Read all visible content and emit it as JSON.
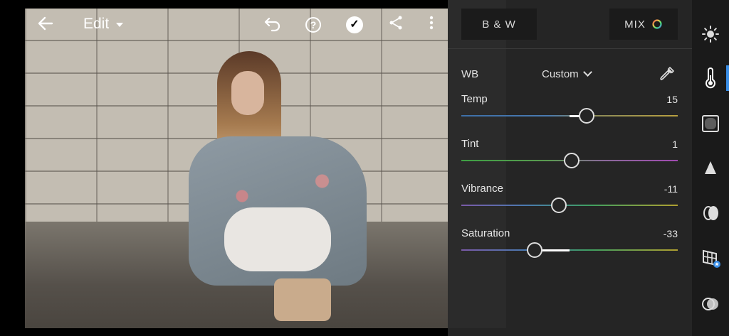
{
  "topbar": {
    "edit_label": "Edit",
    "icons": [
      "back-arrow-icon",
      "undo-icon",
      "help-icon",
      "done-check-icon",
      "share-icon",
      "more-vertical-icon"
    ]
  },
  "panel": {
    "bw_label": "B & W",
    "mix_label": "MIX",
    "wb_label": "WB",
    "wb_value": "Custom",
    "sliders": [
      {
        "label": "Temp",
        "value": "15",
        "position": 0.575
      },
      {
        "label": "Tint",
        "value": "1",
        "position": 0.505
      },
      {
        "label": "Vibrance",
        "value": "-11",
        "position": 0.445
      },
      {
        "label": "Saturation",
        "value": "-33",
        "position": 0.335
      }
    ]
  },
  "rail": {
    "icons": [
      "light-icon",
      "color-icon",
      "effects-icon",
      "detail-icon",
      "optics-icon",
      "geometry-icon",
      "presets-icon"
    ],
    "active": "color-icon",
    "accent": "#3a8ee6"
  }
}
